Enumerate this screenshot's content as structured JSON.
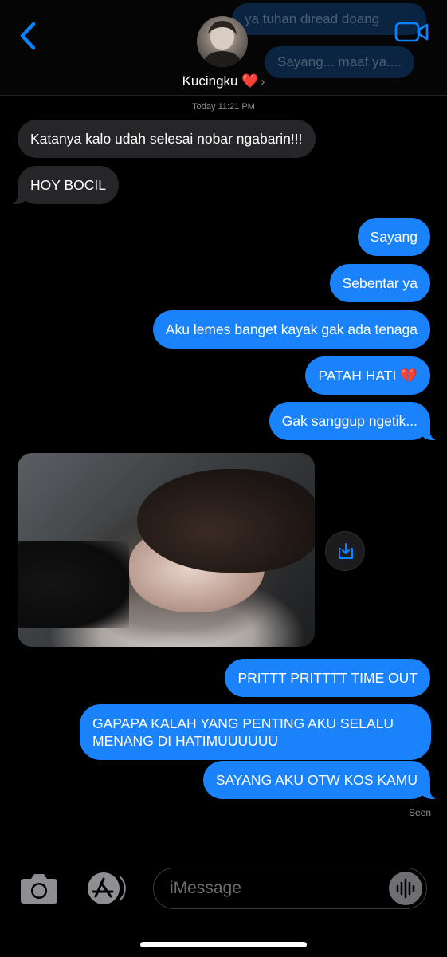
{
  "header": {
    "contact_name": "Kucingku ❤️",
    "chevron": "›"
  },
  "ghost_notifications": [
    "ya tuhan diread doang",
    "Sayang... maaf ya...."
  ],
  "timestamp": "Today 11:21 PM",
  "messages": [
    {
      "from": "them",
      "text": "Katanya kalo udah selesai nobar ngabarin!!!"
    },
    {
      "from": "them",
      "text": "HOY BOCIL"
    },
    {
      "from": "me",
      "text": "Sayang"
    },
    {
      "from": "me",
      "text": "Sebentar ya"
    },
    {
      "from": "me",
      "text": "Aku lemes banget kayak gak ada tenaga"
    },
    {
      "from": "me",
      "text": "PATAH HATI 💔"
    },
    {
      "from": "me",
      "text": "Gak sanggup ngetik..."
    },
    {
      "from": "them",
      "type": "photo"
    },
    {
      "from": "me",
      "text": "PRITTT PRITTTT TIME OUT"
    },
    {
      "from": "me",
      "text_line1": "GAPAPA KALAH YANG PENTING AKU SELALU",
      "text_line2": "MENANG DI HATIMUUUUUU"
    },
    {
      "from": "me",
      "text": "SAYANG AKU OTW KOS KAMU"
    }
  ],
  "status": "Seen",
  "composer": {
    "placeholder": "iMessage"
  },
  "icons": {
    "back": "chevron-left-icon",
    "video": "video-camera-icon",
    "camera": "camera-icon",
    "apps": "app-store-icon",
    "mic": "audio-waveform-icon",
    "download": "download-icon"
  },
  "colors": {
    "outgoing_bubble": "#1a82fb",
    "incoming_bubble": "#262628",
    "accent": "#0a84ff"
  }
}
